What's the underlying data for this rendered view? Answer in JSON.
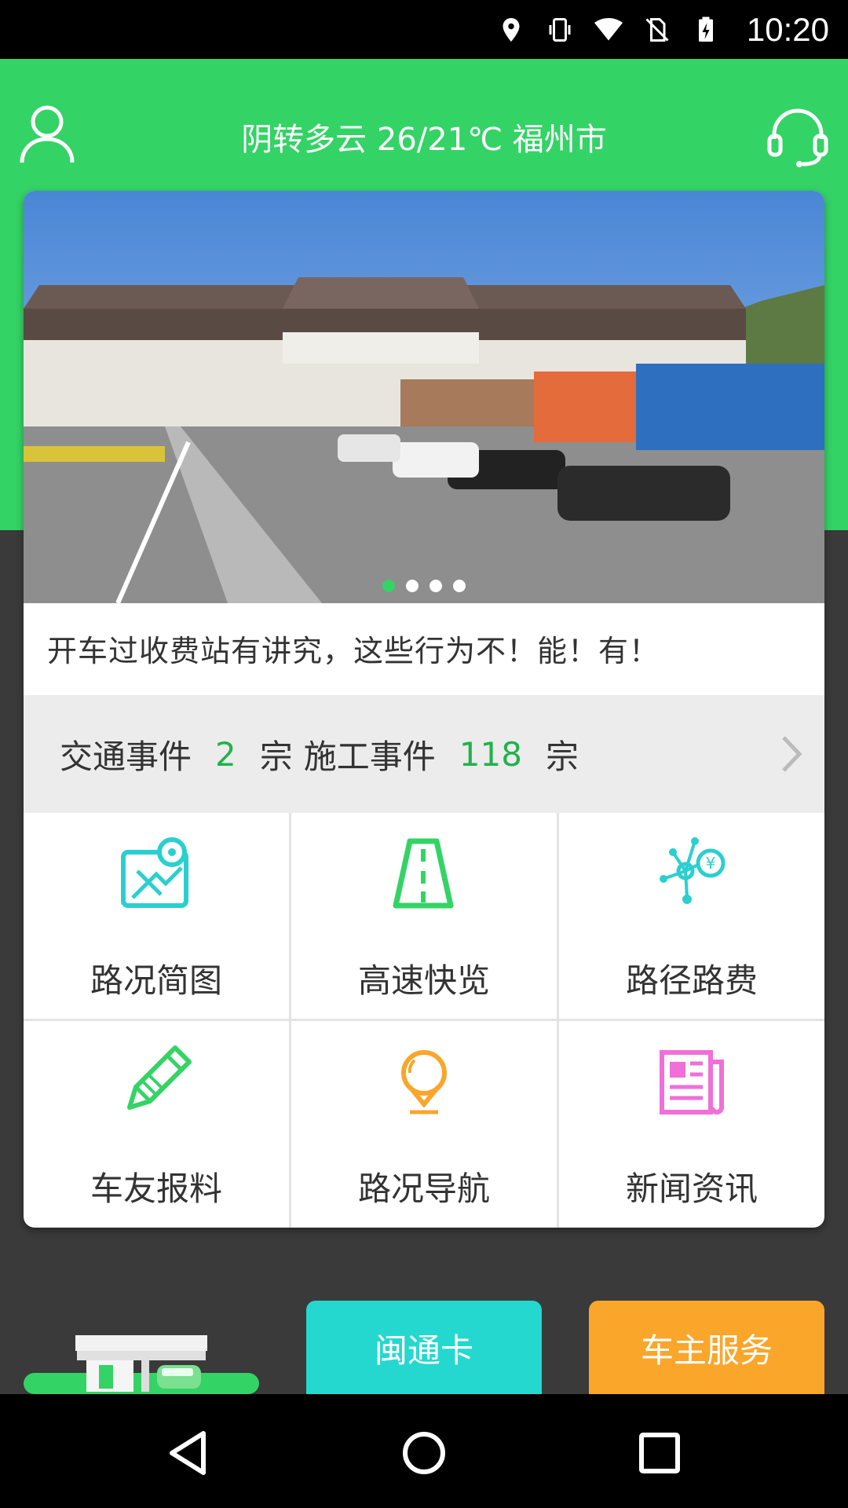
{
  "status_bar": {
    "time": "10:20",
    "icons": [
      "location-icon",
      "vibrate-icon",
      "wifi-icon",
      "no-sim-icon",
      "battery-charging-icon"
    ]
  },
  "header": {
    "weather": "阴转多云 26/21℃ 福州市",
    "left_icon": "user-icon",
    "right_icon": "headset-icon",
    "color": "#34d366"
  },
  "banner": {
    "image_desc": "toll-station-photo",
    "slides": 4,
    "active_slide": 1,
    "headline": "开车过收费站有讲究，这些行为不！能！有！"
  },
  "events": {
    "traffic_label": "交通事件",
    "traffic_count": "2",
    "unit1": "宗",
    "construction_label": "施工事件",
    "construction_count": "118",
    "unit2": "宗"
  },
  "grid": [
    {
      "label": "路况简图",
      "icon": "map-icon",
      "color": "#2bcfd0"
    },
    {
      "label": "高速快览",
      "icon": "road-icon",
      "color": "#34d366"
    },
    {
      "label": "路径路费",
      "icon": "route-fee-icon",
      "color": "#2bcfd0"
    },
    {
      "label": "车友报料",
      "icon": "pencil-icon",
      "color": "#34d366"
    },
    {
      "label": "路况导航",
      "icon": "location-pin-icon",
      "color": "#f9a62b"
    },
    {
      "label": "新闻资讯",
      "icon": "newspaper-icon",
      "color": "#f06fd8"
    }
  ],
  "bottom": {
    "mintong_label": "闽通卡",
    "carowner_label": "车主服务"
  },
  "nav": [
    "back-icon",
    "home-icon",
    "recents-icon"
  ]
}
